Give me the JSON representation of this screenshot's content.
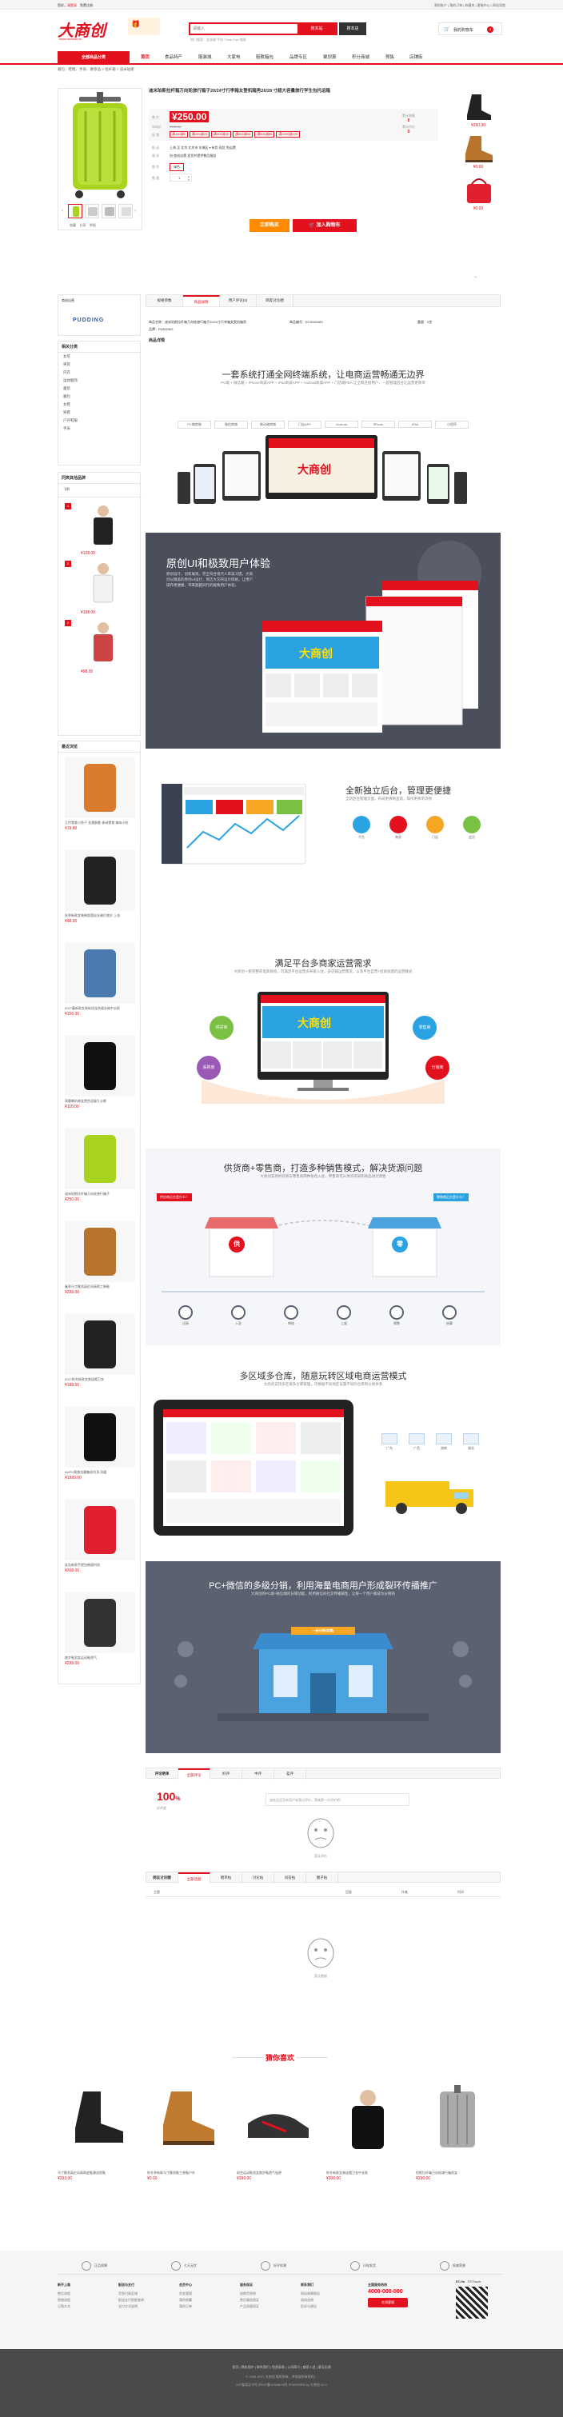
{
  "topbar": {
    "left": "您好，",
    "login": "请登录",
    "register": "免费注册",
    "right": [
      "我的账户",
      "|",
      "我的订单",
      "|",
      "收藏夹",
      "|",
      "客服中心",
      "|",
      "网站导航"
    ]
  },
  "header": {
    "logo": "大商创",
    "logo_sub": "www.dscmall.cn",
    "search_placeholder": "请输入",
    "search_btn": "搜本站",
    "search_btn2": "搜本店",
    "hot": "热门搜索：连衣裙 手机 Think Pad 电脑",
    "cart": "我的购物车",
    "cart_count": "0"
  },
  "nav": {
    "all": "全部商品分类",
    "items": [
      "首页",
      "食品特产",
      "服装城",
      "大家电",
      "鞋靴箱包",
      "品牌专区",
      "聚划算",
      "积分商城",
      "预售",
      "店铺街"
    ]
  },
  "breadcrumb": "箱包、鞋靴、手表、奢侈品 > 拉杆箱 > 迪米珀斯",
  "product": {
    "title": "迪米珀斯拉杆箱万向轮旅行箱子20/24寸行李箱女登机箱男26/28 寸超大容量旅行学生包托运箱",
    "price_label": "售 价",
    "price": "¥250.00",
    "market_label": "市场价",
    "market_price": "¥300.00",
    "promo_label": "促 销",
    "promos": [
      "满100减5",
      "满200减20",
      "满300减30",
      "满500减50",
      "满800减80",
      "满1000减100"
    ],
    "sales_label": "累计销量",
    "sales": "0",
    "reviews_label": "累计评价",
    "reviews": "0",
    "delivery_label": "配 送",
    "delivery": "上海 至 北京 北京市 东城区 ▾ 有货 现货 免运费",
    "service_label": "服 务",
    "service": "由 商创自营 发货并提供售后服务",
    "color_label": "颜 色",
    "color": "绿色",
    "qty_label": "数 量",
    "qty": "1",
    "btn_buy": "立即购买",
    "btn_cart": "加入购物车",
    "thumb_actions": [
      "收藏",
      "分享",
      "举报"
    ]
  },
  "right_recommend": [
    {
      "price": "¥250.00"
    },
    {
      "price": "¥0.00"
    },
    {
      "price": "¥0.00"
    }
  ],
  "shop": {
    "label": "商创自营",
    "brand": "PUDDING"
  },
  "sidebar": {
    "cat_title": "相关分类",
    "cats": [
      "女装",
      "男装",
      "内衣",
      "运动服饰",
      "童装",
      "箱包",
      "女鞋",
      "男鞋",
      "户外鞋服",
      "手表"
    ],
    "rank_title": "同类其他品牌",
    "rank_items": [
      "飞利"
    ],
    "rank_prices": [
      "¥128.00",
      "¥198.00",
      "¥98.00"
    ],
    "hot_title": "最近浏览",
    "hot": [
      {
        "name": "正宗零食小鱼干 金黄酥脆 休闲零食 美味小吃",
        "price": "¥19.80"
      },
      {
        "name": "秋季新款女装韩版宽松长袖打底衫 上衣",
        "price": "¥98.00"
      },
      {
        "name": "2017春新款女装碎花连衣裙长袖中长款",
        "price": "¥156.00"
      },
      {
        "name": "高腰喇叭裤女黑色显瘦九分裤",
        "price": "¥118.00"
      },
      {
        "name": "迪米珀斯拉杆箱万向轮旅行箱子",
        "price": "¥250.00"
      },
      {
        "name": "春季马丁靴男英伦风高帮工装鞋",
        "price": "¥299.00"
      },
      {
        "name": "2017秋冬新款女装连帽卫衣",
        "price": "¥188.00"
      },
      {
        "name": "AUPU奥普浴霸集成吊顶 风暖",
        "price": "¥1999.00"
      },
      {
        "name": "女包新款手提包韩版时尚",
        "price": "¥268.00"
      },
      {
        "name": "跑步鞋男女运动鞋透气",
        "price": "¥299.00"
      }
    ]
  },
  "tabs": {
    "items": [
      "规格参数",
      "商品详情",
      "用户评论(0)",
      "网友讨论圈"
    ],
    "active": 1
  },
  "specs": {
    "name": "商品名称：迪米珀斯拉杆箱万向轮旅行箱子20/24寸行李箱女登机箱男",
    "code": "商品编号：ECS000483",
    "brand": "品牌：PUDDING",
    "weight": "重量：0克"
  },
  "detail_tab": "商品详情",
  "sections": {
    "s1_title": "一套系统打通全网终端系统，让电商运营畅通无边界",
    "s1_sub": "PC端 + 微信端 + iPhone商城APP + iPad商城APP + Android商城APP + 门店端PDA 让全网连接用户，一套管理后台让运营更简单",
    "s1_tags": [
      "PC端商城",
      "微信商城",
      "移动端商城",
      "门店APP",
      "Android",
      "iPhone",
      "iPad",
      "小程序"
    ],
    "s2_title": "原创UI和极致用户体验",
    "s2_sub": "原创设计，创新展现，完全符合现代人审美习惯。大商创以精美的原创UI设计，简洁大方的设计风格，让用户操作更便捷，带来超越同行的极致用户体验。",
    "s2_tags": [
      "原创UI",
      "用户体验"
    ],
    "s3_title": "全新独立后台，管理更便捷",
    "s3_sub": "全新后台管理页面，布局更清晰直观，操作更简单流畅",
    "s3_icons": [
      "平台",
      "商家",
      "门店",
      "会员"
    ],
    "s4_title": "满足平台多商家运营需求",
    "s4_sub": "大商创一套完整的电商系统，可满足平台运营多商家入驻，多店铺运营需求，以及平台自营+招商加盟的运营模式",
    "s4_nodes": [
      "供货商",
      "零售商",
      "采购商",
      "分销商"
    ],
    "s5_title": "供货商+零售商，打造多种销售模式，解决货源问题",
    "s5_sub": "大商创支持供货商与零售商两种角色入驻，零售商可从供货商采购商品进行销售",
    "s5_labels": [
      "供",
      "零",
      "供应商后台是什么？",
      "零售商后台是什么？"
    ],
    "s5_steps": [
      "注册",
      "入驻",
      "审核",
      "上架",
      "销售",
      "结算"
    ],
    "s6_title": "多区域多仓库，随意玩转区域电商运营模式",
    "s6_sub": "大商创支持多区域多仓库管理，可根据不同地区设置不同的仓库和价格体系",
    "s6_cities": [
      "广东",
      "广西",
      "湖南",
      "湖北"
    ],
    "s7_title": "PC+微信的多级分销，利用海量电商用户形成裂环传播推广",
    "s7_sub": "大商创的PC端+微信端的分销功能，利用微信的社交传播属性，让每一个用户都成为分销商",
    "s7_store": "一级分销(店铺)"
  },
  "comments": {
    "tabs": [
      "评论晒单",
      "全部评论",
      "好评",
      "中评",
      "差评"
    ],
    "score": "100",
    "percent": "%",
    "score_label": "好评度",
    "empty": "暂无评价",
    "desc": "该商品还没有用户发表过评价，我来第一位评价吧！"
  },
  "discuss": {
    "tabs": [
      "网友讨论圈",
      "全部话题",
      "晒单帖",
      "讨论帖",
      "问答帖",
      "圈子帖"
    ],
    "cols": [
      "主题",
      "回复",
      "作者",
      "时间"
    ],
    "empty": "暂无数据"
  },
  "guess": {
    "title": "猜你喜欢",
    "items": [
      {
        "name": "马丁靴男英伦风高帮皮鞋潮流男鞋",
        "price": "¥333.00"
      },
      {
        "name": "秋冬季新款马丁靴男鞋工装鞋户外",
        "price": "¥0.00"
      },
      {
        "name": "耐克运动鞋男女跑步鞋透气轻便",
        "price": "¥299.00"
      },
      {
        "name": "秋冬新款女装连帽卫衣中长款",
        "price": "¥300.00"
      },
      {
        "name": "铝框拉杆箱万向轮旅行箱男女",
        "price": "¥330.00"
      }
    ]
  },
  "footer": {
    "guarantees": [
      "正品保障",
      "七天无忧",
      "好评如潮",
      "闪电发货",
      "权威荣誉"
    ],
    "cols": [
      {
        "title": "新手上路",
        "links": [
          "售后流程",
          "购物流程",
          "订购方式"
        ]
      },
      {
        "title": "配送与支付",
        "links": [
          "货到付款区域",
          "配送支付智能查询",
          "支付方式说明"
        ]
      },
      {
        "title": "会员中心",
        "links": [
          "资金管理",
          "我的收藏",
          "我的订单"
        ]
      },
      {
        "title": "服务保证",
        "links": [
          "退换货原则",
          "售后服务保证",
          "产品质量保证"
        ]
      },
      {
        "title": "联系我们",
        "links": [
          "网站故障报告",
          "选机咨询",
          "投诉与建议"
        ]
      }
    ],
    "hotline_title": "全国服务热线",
    "hotline": "4000-000-000",
    "online_btn": "在线客服",
    "qr_tabs": [
      "ECJia",
      "ECTouch"
    ],
    "links": "首页 | 隐私保护 | 联系我们 | 免责条款 | 公司简介 | 商家入驻 | 意见反馈",
    "copyright": "© 2005-2017 大商创 版权所有，并保留所有权利。",
    "icp": "ICP备案证书号:沪ICP备12345678号 POWERED by 大商创 v2.0"
  }
}
